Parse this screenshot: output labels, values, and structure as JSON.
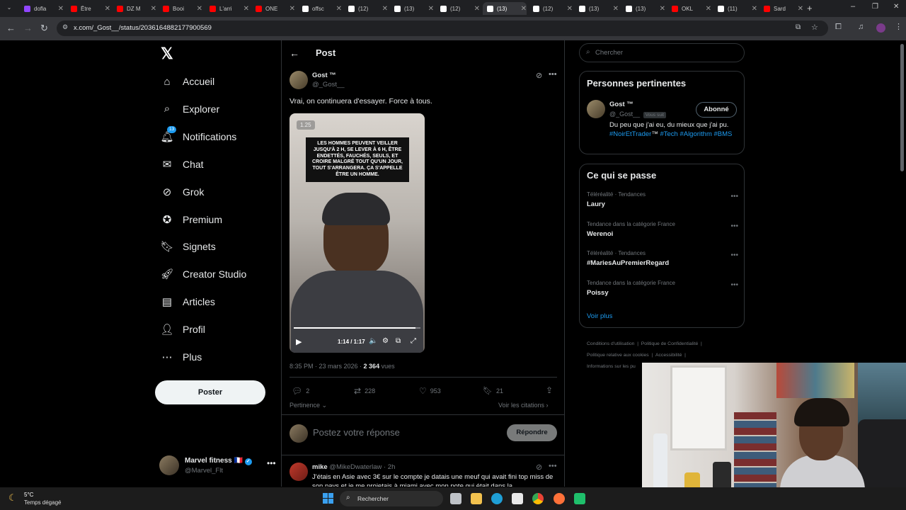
{
  "browser": {
    "tabs": [
      {
        "label": "dofla",
        "color": "#9146ff"
      },
      {
        "label": "Être",
        "color": "#ff0000"
      },
      {
        "label": "DZ M",
        "color": "#ff0000"
      },
      {
        "label": "Booi",
        "color": "#ff0000"
      },
      {
        "label": "L'arri",
        "color": "#ff0000"
      },
      {
        "label": "ONE",
        "color": "#ff0000"
      },
      {
        "label": "offsc",
        "color": "#ffffff"
      },
      {
        "label": "(12)",
        "color": "#ffffff"
      },
      {
        "label": "(13)",
        "color": "#ffffff"
      },
      {
        "label": "(12)",
        "color": "#ffffff"
      },
      {
        "label": "(13)",
        "color": "#ffffff"
      },
      {
        "label": "(12)",
        "color": "#ffffff"
      },
      {
        "label": "(13)",
        "color": "#ffffff"
      },
      {
        "label": "(13)",
        "color": "#ffffff"
      },
      {
        "label": "OKL",
        "color": "#ff0000"
      },
      {
        "label": "(11)",
        "color": "#ffffff"
      },
      {
        "label": "Sard",
        "color": "#ff0000"
      }
    ],
    "url": "x.com/_Gost__/status/2036164882177900569"
  },
  "nav": {
    "logo": "𝕏",
    "items": [
      {
        "label": "Accueil",
        "icon": "home-icon"
      },
      {
        "label": "Explorer",
        "icon": "search-icon"
      },
      {
        "label": "Notifications",
        "icon": "bell-icon"
      },
      {
        "label": "Chat",
        "icon": "mail-icon"
      },
      {
        "label": "Grok",
        "icon": "grok-icon"
      },
      {
        "label": "Premium",
        "icon": "premium-icon"
      },
      {
        "label": "Signets",
        "icon": "bookmark-icon"
      },
      {
        "label": "Creator Studio",
        "icon": "rocket-icon"
      },
      {
        "label": "Articles",
        "icon": "articles-icon"
      },
      {
        "label": "Profil",
        "icon": "person-icon"
      },
      {
        "label": "Plus",
        "icon": "more-circle-icon"
      }
    ],
    "notif_badge": "13",
    "post_button": "Poster",
    "account": {
      "name": "Marvel fitness",
      "flag": "🇫🇷",
      "handle": "@Marvel_Flt"
    }
  },
  "post": {
    "header_title": "Post",
    "author": {
      "name": "Gost ™",
      "handle": "@_Gost__"
    },
    "text": "Vrai, on continuera d'essayer. Force à tous.",
    "video": {
      "speed": "1.25",
      "caption": "LES HOMMES PEUVENT VEILLER JUSQU'À 2 H, SE LEVER À 6 H, ÊTRE ENDETTÉS, FAUCHÉS, SEULS, ET CROIRE MALGRÉ TOUT QU'UN JOUR, TOUT S'ARRANGERA. ÇA S'APPELLE ÊTRE UN HOMME.",
      "time": "1:14 / 1:17",
      "progress": 0.96
    },
    "meta_time": "8:35 PM · 23 mars 2026 · ",
    "views": "2 364",
    "views_label": " vues",
    "stats": {
      "replies": "2",
      "reposts": "228",
      "likes": "953",
      "bookmarks": "21"
    },
    "sort_label": "Pertinence",
    "quotes_label": "Voir les citations",
    "reply_placeholder": "Postez votre réponse",
    "reply_button": "Répondre"
  },
  "reply": {
    "name": "mike",
    "handle": "@MikeDwaterlaw",
    "time": "· 2h",
    "text": "J'étais en Asie avec 3€ sur le compte je datais une meuf qui avait fini top miss de son pays et je me projetais à miami avec mon pote qui était dans la"
  },
  "sidebar": {
    "search_placeholder": "Chercher",
    "relevant": {
      "title": "Personnes pertinentes",
      "name": "Gost ™",
      "handle": "@_Gost__",
      "follows_you": "Vous suit",
      "button": "Abonné",
      "bio_plain": "Du peu que j'ai eu, du mieux que j'ai pu. ",
      "bio_tags": [
        "#NoirEtTrader",
        "™ ",
        "#Tech",
        " ",
        "#Algorithm",
        " ",
        "#BMS"
      ]
    },
    "trending": {
      "title": "Ce qui se passe",
      "items": [
        {
          "category": "Téléréalité · Tendances",
          "name": "Laury"
        },
        {
          "category": "Tendance dans la catégorie France",
          "name": "Werenoi"
        },
        {
          "category": "Téléréalité · Tendances",
          "name": "#MariesAuPremierRegard"
        },
        {
          "category": "Tendance dans la catégorie France",
          "name": "Poissy"
        }
      ],
      "more": "Voir plus"
    },
    "footer": [
      "Conditions d'utilisation",
      "Politique de Confidentialité",
      "Politique relative aux cookies",
      "Accessibilité",
      "Informations sur les pu"
    ]
  },
  "taskbar": {
    "weather_temp": "5°C",
    "weather_desc": "Temps dégagé",
    "search": "Rechercher"
  }
}
